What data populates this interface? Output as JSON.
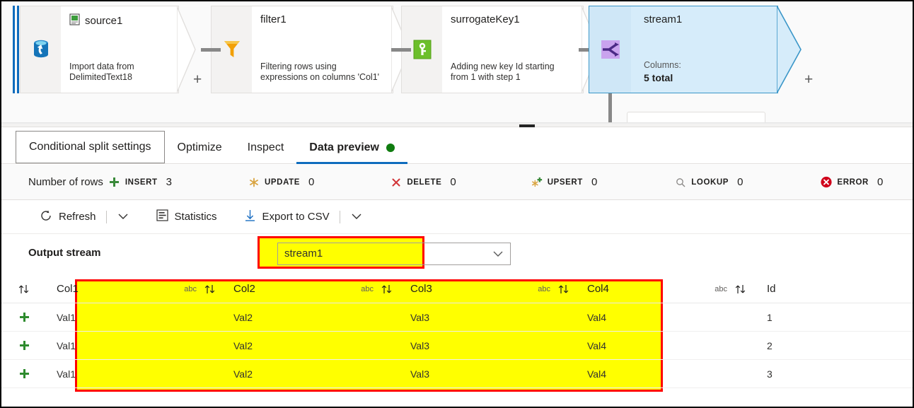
{
  "canvas": {
    "nodes": [
      {
        "name": "source1",
        "description_line1": "Import data from",
        "description_line2": "DelimitedText18",
        "icon": "delimited-text-icon",
        "side_icon": "source-database-icon",
        "plus": "+"
      },
      {
        "name": "filter1",
        "description_line1": "Filtering rows using",
        "description_line2": "expressions on columns 'Col1'",
        "icon": "filter-funnel-icon",
        "plus": "+"
      },
      {
        "name": "surrogateKey1",
        "description_line1": "Adding new key Id starting",
        "description_line2": "from 1 with step 1",
        "icon": "surrogate-key-icon",
        "plus": "+"
      }
    ],
    "selected_node": {
      "name": "stream1",
      "columns_label": "Columns:",
      "columns_total": "5 total",
      "icon": "conditional-split-icon",
      "plus": "+",
      "fill": "#d6ecfa",
      "border": "#3a96c8"
    }
  },
  "tabs": [
    {
      "label": "Conditional split settings",
      "active": false,
      "boxed": true
    },
    {
      "label": "Optimize",
      "active": false,
      "boxed": false
    },
    {
      "label": "Inspect",
      "active": false,
      "boxed": false
    },
    {
      "label": "Data preview",
      "active": true,
      "boxed": false,
      "status_dot": "#107c10"
    }
  ],
  "counters": {
    "label": "Number of rows",
    "items": [
      {
        "label": "INSERT",
        "value": "3",
        "icon": "plus-icon",
        "color": "#3a8a3a"
      },
      {
        "label": "UPDATE",
        "value": "0",
        "icon": "asterisk-icon",
        "color": "#d9a441"
      },
      {
        "label": "DELETE",
        "value": "0",
        "icon": "x-icon",
        "color": "#d13438"
      },
      {
        "label": "UPSERT",
        "value": "0",
        "icon": "asterisk-plus-icon",
        "color": "#d9a441"
      },
      {
        "label": "LOOKUP",
        "value": "0",
        "icon": "magnifier-icon",
        "color": "#8a8886"
      },
      {
        "label": "ERROR",
        "value": "0",
        "icon": "error-circle-icon",
        "color": "#d13438"
      }
    ]
  },
  "toolbar": {
    "refresh_label": "Refresh",
    "refresh_icon": "refresh-icon",
    "refresh_caret": "chevron-down-icon",
    "statistics_label": "Statistics",
    "statistics_icon": "statistics-icon",
    "export_label": "Export to CSV",
    "export_icon": "download-icon",
    "export_caret": "chevron-down-icon"
  },
  "output_stream": {
    "label": "Output stream",
    "value": "stream1",
    "caret": "chevron-down-icon",
    "highlight_fill": "#ffff00",
    "highlight_border": "#ff0000"
  },
  "table": {
    "sort_icon": "sort-arrows-icon",
    "type_label": "abc",
    "row_expand_icon": "plus-icon",
    "columns": [
      "Col1",
      "Col2",
      "Col3",
      "Col4",
      "Id"
    ],
    "rows": [
      [
        "Val1",
        "Val2",
        "Val3",
        "Val4",
        "1"
      ],
      [
        "Val1",
        "Val2",
        "Val3",
        "Val4",
        "2"
      ],
      [
        "Val1",
        "Val2",
        "Val3",
        "Val4",
        "3"
      ]
    ],
    "highlight_fill": "#ffff00",
    "highlight_border": "#ff0000"
  }
}
